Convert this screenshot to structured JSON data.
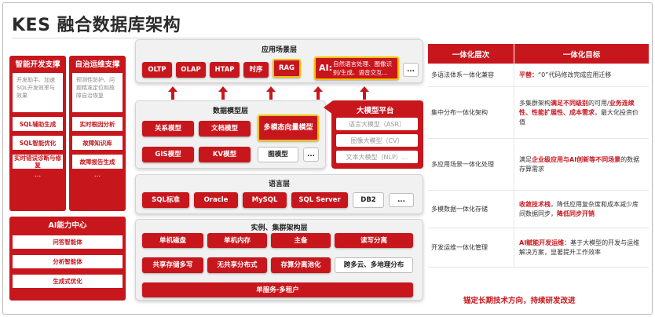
{
  "title": "KES 融合数据库架构",
  "left": {
    "dev": {
      "title": "智能开发支撑",
      "desc": "开发助手、加速SQL开发效率与效果",
      "items": [
        "SQL辅助生成",
        "SQL智能优化",
        "实时错误诊断与修复"
      ],
      "dots": "..."
    },
    "ops": {
      "title": "自治运维支撑",
      "desc": "预测性防护、问题精准定位和故障自治恢复",
      "items": [
        "实时根因分析",
        "故障知识库",
        "故障报告生成"
      ],
      "dots": "..."
    },
    "ai": {
      "title": "AI能力中心",
      "items": [
        "问答智能体",
        "分析智能体",
        "生成式优化"
      ]
    }
  },
  "layers": {
    "app": {
      "title": "应用场景层",
      "chips": [
        "OLTP",
        "OLAP",
        "HTAP",
        "时序",
        "RAG"
      ],
      "ai_big": "AI:",
      "ai_small": "自然语言处理、图像识别/生成、语音交互...",
      "more": "..."
    },
    "model": {
      "title": "数据模型层",
      "chips": [
        "关系模型",
        "文档模型",
        "多模态向量模型",
        "GIS模型",
        "KV模型",
        "图模型"
      ],
      "more": "..."
    },
    "llm": {
      "title": "大模型平台",
      "items": [
        "语言大模型（ASR）",
        "图像大模型（CV）",
        "文本大模型（NLP）..."
      ]
    },
    "lang": {
      "title": "语言层",
      "chips": [
        "SQL标准",
        "Oracle",
        "MySQL",
        "SQL Server",
        "DB2"
      ],
      "more": "..."
    },
    "cluster": {
      "title": "实例、集群架构层",
      "chips": [
        "单机磁盘",
        "单机内存",
        "主备",
        "读写分离",
        "共享存储多写",
        "无共享分布式",
        "存算分离池化",
        "跨多云、多地理分布"
      ],
      "bottom": "单服务-多租户"
    }
  },
  "table": {
    "headers": [
      "一体化层次",
      "一体化目标"
    ],
    "rows": [
      {
        "level": "多语法体系一体化兼容",
        "parts": [
          {
            "t": "平替：",
            "r": true
          },
          {
            "t": "“0”代码修改完成应用迁移",
            "r": false
          }
        ]
      },
      {
        "level": "集中分布一体化架构",
        "parts": [
          {
            "t": "多集群架构",
            "r": false
          },
          {
            "t": "满足不同级别",
            "r": true
          },
          {
            "t": "的可用/",
            "r": false
          },
          {
            "t": "业务连续性、性能扩展性、成本需求",
            "r": true
          },
          {
            "t": "，最大化投资价值",
            "r": false
          }
        ]
      },
      {
        "level": "多应用场景一体化处理",
        "parts": [
          {
            "t": "满足",
            "r": false
          },
          {
            "t": "企业级应用与AI创新等不同场景",
            "r": true
          },
          {
            "t": "的数据存算需求",
            "r": false
          }
        ]
      },
      {
        "level": "多模数据一体化存储",
        "parts": [
          {
            "t": "收敛技术栈",
            "r": true
          },
          {
            "t": "，降低应用复杂度和成本减少库间数据同步，",
            "r": false
          },
          {
            "t": "降低同步开销",
            "r": true
          }
        ]
      },
      {
        "level": "开发运维一体化管理",
        "parts": [
          {
            "t": "AI赋能开发运维",
            "r": true
          },
          {
            "t": "：基于大模型的开发与运维解决方案，显著提升工作效率",
            "r": false
          }
        ]
      }
    ]
  },
  "footer": "锚定长期技术方向，持续研发改进",
  "colors": {
    "brand_red": "#c8161d",
    "highlight": "#f2c200"
  }
}
